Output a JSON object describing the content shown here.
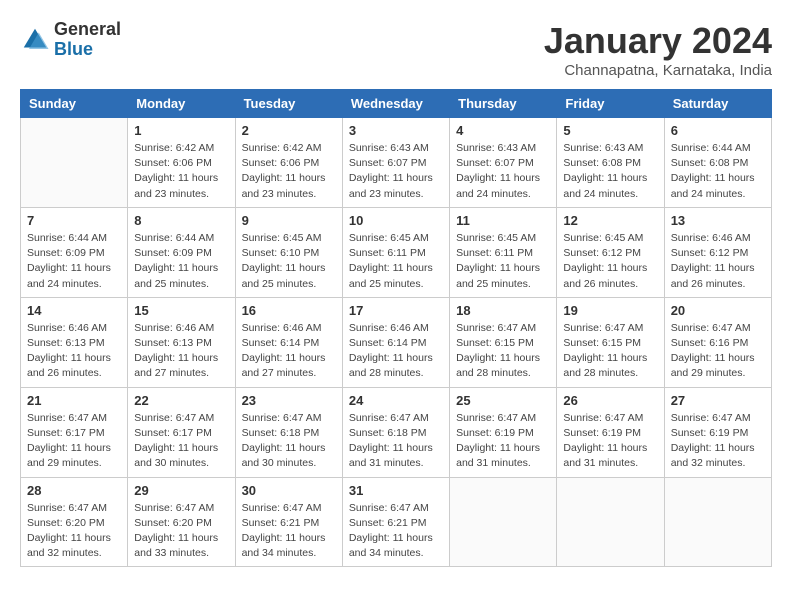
{
  "header": {
    "logo": {
      "general": "General",
      "blue": "Blue"
    },
    "title": "January 2024",
    "location": "Channapatna, Karnataka, India"
  },
  "days_of_week": [
    "Sunday",
    "Monday",
    "Tuesday",
    "Wednesday",
    "Thursday",
    "Friday",
    "Saturday"
  ],
  "weeks": [
    [
      {
        "day": "",
        "info": ""
      },
      {
        "day": "1",
        "info": "Sunrise: 6:42 AM\nSunset: 6:06 PM\nDaylight: 11 hours\nand 23 minutes."
      },
      {
        "day": "2",
        "info": "Sunrise: 6:42 AM\nSunset: 6:06 PM\nDaylight: 11 hours\nand 23 minutes."
      },
      {
        "day": "3",
        "info": "Sunrise: 6:43 AM\nSunset: 6:07 PM\nDaylight: 11 hours\nand 23 minutes."
      },
      {
        "day": "4",
        "info": "Sunrise: 6:43 AM\nSunset: 6:07 PM\nDaylight: 11 hours\nand 24 minutes."
      },
      {
        "day": "5",
        "info": "Sunrise: 6:43 AM\nSunset: 6:08 PM\nDaylight: 11 hours\nand 24 minutes."
      },
      {
        "day": "6",
        "info": "Sunrise: 6:44 AM\nSunset: 6:08 PM\nDaylight: 11 hours\nand 24 minutes."
      }
    ],
    [
      {
        "day": "7",
        "info": "Sunrise: 6:44 AM\nSunset: 6:09 PM\nDaylight: 11 hours\nand 24 minutes."
      },
      {
        "day": "8",
        "info": "Sunrise: 6:44 AM\nSunset: 6:09 PM\nDaylight: 11 hours\nand 25 minutes."
      },
      {
        "day": "9",
        "info": "Sunrise: 6:45 AM\nSunset: 6:10 PM\nDaylight: 11 hours\nand 25 minutes."
      },
      {
        "day": "10",
        "info": "Sunrise: 6:45 AM\nSunset: 6:11 PM\nDaylight: 11 hours\nand 25 minutes."
      },
      {
        "day": "11",
        "info": "Sunrise: 6:45 AM\nSunset: 6:11 PM\nDaylight: 11 hours\nand 25 minutes."
      },
      {
        "day": "12",
        "info": "Sunrise: 6:45 AM\nSunset: 6:12 PM\nDaylight: 11 hours\nand 26 minutes."
      },
      {
        "day": "13",
        "info": "Sunrise: 6:46 AM\nSunset: 6:12 PM\nDaylight: 11 hours\nand 26 minutes."
      }
    ],
    [
      {
        "day": "14",
        "info": "Sunrise: 6:46 AM\nSunset: 6:13 PM\nDaylight: 11 hours\nand 26 minutes."
      },
      {
        "day": "15",
        "info": "Sunrise: 6:46 AM\nSunset: 6:13 PM\nDaylight: 11 hours\nand 27 minutes."
      },
      {
        "day": "16",
        "info": "Sunrise: 6:46 AM\nSunset: 6:14 PM\nDaylight: 11 hours\nand 27 minutes."
      },
      {
        "day": "17",
        "info": "Sunrise: 6:46 AM\nSunset: 6:14 PM\nDaylight: 11 hours\nand 28 minutes."
      },
      {
        "day": "18",
        "info": "Sunrise: 6:47 AM\nSunset: 6:15 PM\nDaylight: 11 hours\nand 28 minutes."
      },
      {
        "day": "19",
        "info": "Sunrise: 6:47 AM\nSunset: 6:15 PM\nDaylight: 11 hours\nand 28 minutes."
      },
      {
        "day": "20",
        "info": "Sunrise: 6:47 AM\nSunset: 6:16 PM\nDaylight: 11 hours\nand 29 minutes."
      }
    ],
    [
      {
        "day": "21",
        "info": "Sunrise: 6:47 AM\nSunset: 6:17 PM\nDaylight: 11 hours\nand 29 minutes."
      },
      {
        "day": "22",
        "info": "Sunrise: 6:47 AM\nSunset: 6:17 PM\nDaylight: 11 hours\nand 30 minutes."
      },
      {
        "day": "23",
        "info": "Sunrise: 6:47 AM\nSunset: 6:18 PM\nDaylight: 11 hours\nand 30 minutes."
      },
      {
        "day": "24",
        "info": "Sunrise: 6:47 AM\nSunset: 6:18 PM\nDaylight: 11 hours\nand 31 minutes."
      },
      {
        "day": "25",
        "info": "Sunrise: 6:47 AM\nSunset: 6:19 PM\nDaylight: 11 hours\nand 31 minutes."
      },
      {
        "day": "26",
        "info": "Sunrise: 6:47 AM\nSunset: 6:19 PM\nDaylight: 11 hours\nand 31 minutes."
      },
      {
        "day": "27",
        "info": "Sunrise: 6:47 AM\nSunset: 6:19 PM\nDaylight: 11 hours\nand 32 minutes."
      }
    ],
    [
      {
        "day": "28",
        "info": "Sunrise: 6:47 AM\nSunset: 6:20 PM\nDaylight: 11 hours\nand 32 minutes."
      },
      {
        "day": "29",
        "info": "Sunrise: 6:47 AM\nSunset: 6:20 PM\nDaylight: 11 hours\nand 33 minutes."
      },
      {
        "day": "30",
        "info": "Sunrise: 6:47 AM\nSunset: 6:21 PM\nDaylight: 11 hours\nand 34 minutes."
      },
      {
        "day": "31",
        "info": "Sunrise: 6:47 AM\nSunset: 6:21 PM\nDaylight: 11 hours\nand 34 minutes."
      },
      {
        "day": "",
        "info": ""
      },
      {
        "day": "",
        "info": ""
      },
      {
        "day": "",
        "info": ""
      }
    ]
  ]
}
